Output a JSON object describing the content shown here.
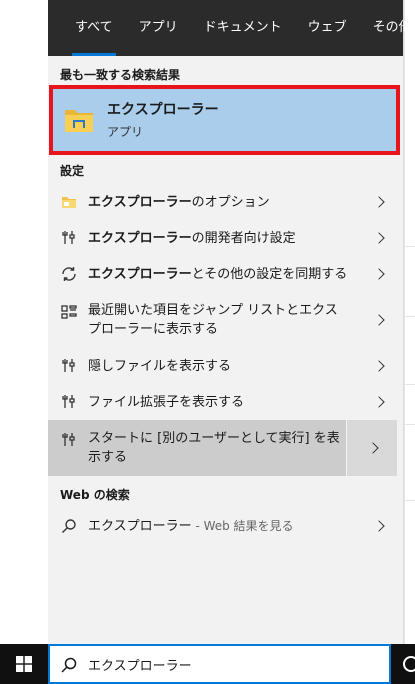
{
  "tabs": [
    {
      "label": "すべて",
      "active": true
    },
    {
      "label": "アプリ"
    },
    {
      "label": "ドキュメント"
    },
    {
      "label": "ウェブ"
    },
    {
      "label": "その他"
    }
  ],
  "best_match": {
    "section_title": "最も一致する検索結果",
    "title": "エクスプローラー",
    "subtitle": "アプリ",
    "icon": "folder-icon"
  },
  "settings": {
    "section_title": "設定",
    "items": [
      {
        "bold": "エクスプローラー",
        "rest": "のオプション",
        "icon": "folder-options-icon"
      },
      {
        "bold": "エクスプローラー",
        "rest": "の開発者向け設定",
        "icon": "developer-settings-icon"
      },
      {
        "bold": "エクスプローラー",
        "rest": "とその他の設定を同期する",
        "icon": "sync-icon"
      },
      {
        "line1": "最近開いた項目をジャンプ リストとエクス",
        "line2": "プローラーに表示する",
        "icon": "jump-list-icon"
      },
      {
        "text": "隠しファイルを表示する",
        "icon": "developer-settings-icon"
      },
      {
        "text": "ファイル拡張子を表示する",
        "icon": "developer-settings-icon"
      },
      {
        "line1": "スタートに [別のユーザーとして実行] を表",
        "line2": "示する",
        "icon": "developer-settings-icon"
      }
    ]
  },
  "web": {
    "section_title": "Web の検索",
    "query": "エクスプローラー",
    "suffix": " - Web 結果を見る",
    "icon": "search-icon"
  },
  "taskbar": {
    "search_value": "エクスプローラー"
  },
  "colors": {
    "accent": "#0078d7",
    "selection": "#a9cdea",
    "highlight_border": "#e8141c",
    "topbar": "#2b2b2b"
  }
}
